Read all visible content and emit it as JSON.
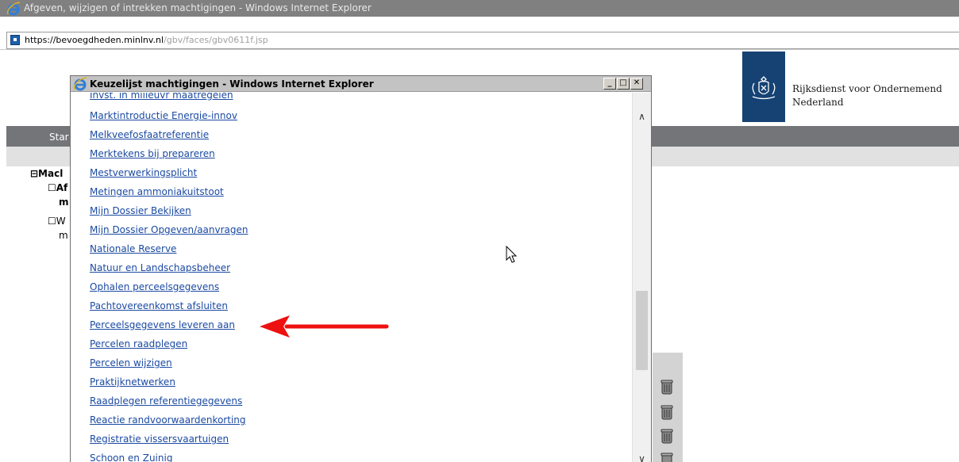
{
  "main_window": {
    "title": "Afgeven, wijzigen of intrekken machtigingen - Windows Internet Explorer",
    "address_host": "https://bevoegdheden.minlnv.nl",
    "address_path": "/gbv/faces/gbv0611f.jsp"
  },
  "page": {
    "org_line1": "Rijksdienst voor Ondernemend",
    "org_line2": "Nederland",
    "nav_start": "Star",
    "tree": {
      "root": "⊟Macl",
      "item1_line1": "☐Af",
      "item1_line2": "m",
      "item2_line1": "☐W",
      "item2_line2": "m"
    }
  },
  "popup": {
    "title": "Keuzelijst machtigingen - Windows Internet Explorer",
    "buttons": {
      "minimize": "_",
      "maximize": "□",
      "close": "✕"
    },
    "items": [
      "Invst. in milieuvr maatregelen",
      "Marktintroductie Energie-innov",
      "Melkveefosfaatreferentie",
      "Merktekens bij prepareren",
      "Mestverwerkingsplicht",
      "Metingen ammoniakuitstoot",
      "Mijn Dossier Bekijken",
      "Mijn Dossier Opgeven/aanvragen",
      "Nationale Reserve",
      "Natuur en Landschapsbeheer",
      "Ophalen perceelsgegevens",
      "Pachtovereenkomst afsluiten",
      "Perceelsgegevens leveren aan",
      "Percelen raadplegen",
      "Percelen wijzigen",
      "Praktijknetwerken",
      "Raadplegen referentiegegevens",
      "Reactie randvoorwaardenkorting",
      "Registratie vissersvaartuigen",
      "Schoon en Zuinig"
    ],
    "scroll": {
      "up": "∧",
      "down": "∨"
    }
  },
  "colors": {
    "link": "#1b4aa2",
    "annotation_arrow": "#ee1111",
    "logo_blue": "#154273",
    "nav_grey": "#747579"
  }
}
